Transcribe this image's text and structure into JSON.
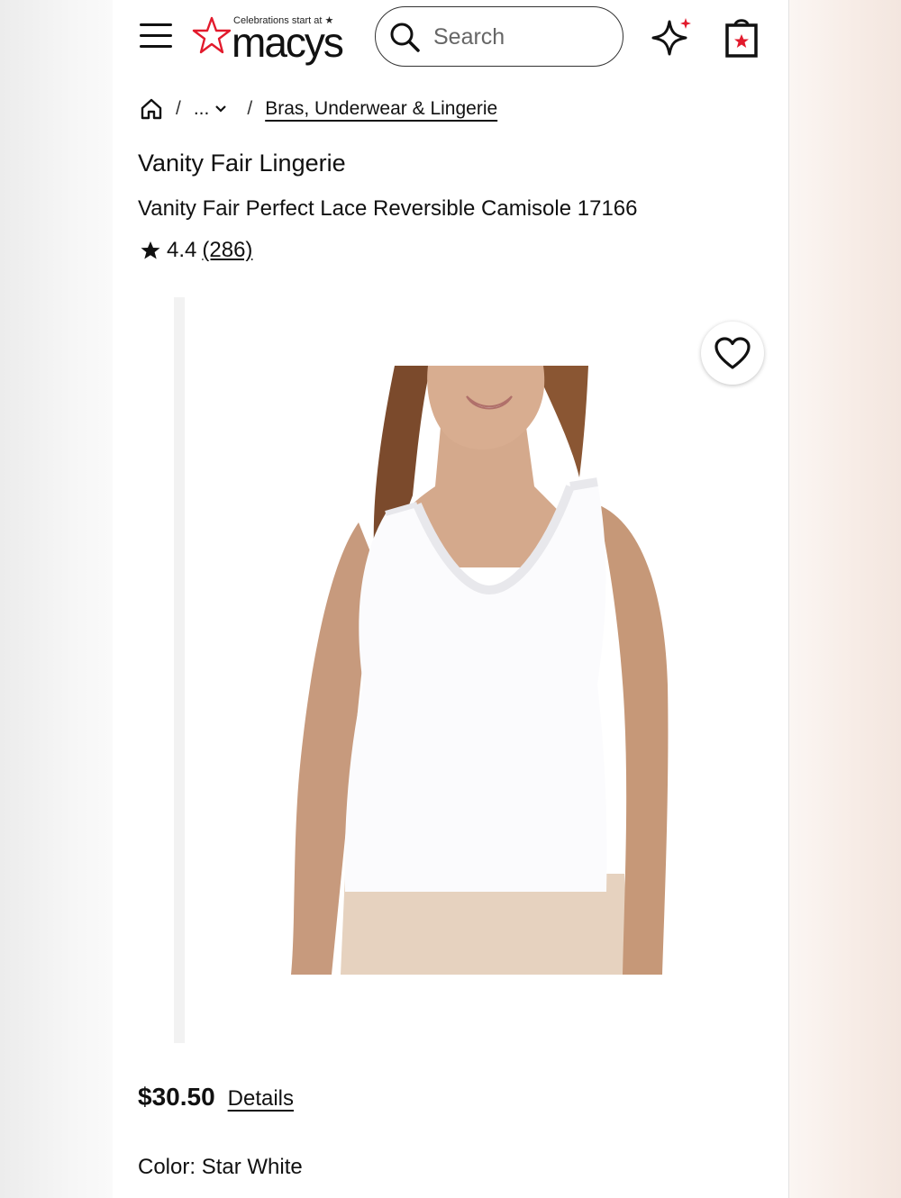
{
  "header": {
    "logo_tagline": "Celebrations start at ★",
    "logo_wordmark": "macys",
    "search_placeholder": "Search",
    "icons": [
      "menu-icon",
      "macys-star-icon",
      "search-icon",
      "sparkle-icon",
      "shopping-bag-icon"
    ]
  },
  "breadcrumb": {
    "ellipsis": "...",
    "separator": "/",
    "category": "Bras, Underwear & Lingerie"
  },
  "product": {
    "brand": "Vanity Fair Lingerie",
    "title": "Vanity Fair Perfect Lace Reversible Camisole 17166",
    "rating": "4.4",
    "review_count": "(286)",
    "price": "$30.50",
    "details_link": "Details",
    "color_label": "Color: Star White"
  },
  "colors": {
    "brand_red": "#e21a2c",
    "text": "#111111"
  }
}
